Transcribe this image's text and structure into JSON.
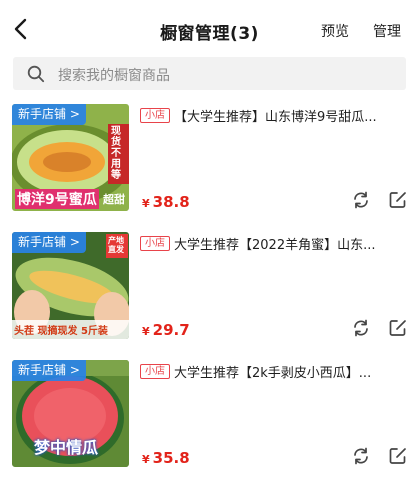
{
  "header": {
    "title": "橱窗管理(3)",
    "preview_label": "预览",
    "manage_label": "管理"
  },
  "search": {
    "placeholder": "搜索我的橱窗商品"
  },
  "items": [
    {
      "new_shop_tag": "新手店铺 >",
      "shop_badge": "小店",
      "title": "【大学生推荐】山东博洋9号甜瓜...",
      "currency": "¥",
      "price": "38.8",
      "thumb_caption": "博洋9号蜜瓜",
      "thumb_caption2": "超甜",
      "thumb_sticker": "现货不用等"
    },
    {
      "new_shop_tag": "新手店铺 >",
      "shop_badge": "小店",
      "title": "大学生推荐【2022羊角蜜】山东...",
      "currency": "¥",
      "price": "29.7",
      "thumb_caption": "头茬 现摘现发 5斤装",
      "thumb_sticker": "产地直发"
    },
    {
      "new_shop_tag": "新手店铺 >",
      "shop_badge": "小店",
      "title": "大学生推荐【2k手剥皮小西瓜】...",
      "currency": "¥",
      "price": "35.8",
      "thumb_caption": "梦中情瓜"
    }
  ],
  "colors": {
    "price": "#e2231a",
    "badge": "#e8434a",
    "new_shop_tag": "#2882e6",
    "search_bg": "#f2f2f2"
  }
}
